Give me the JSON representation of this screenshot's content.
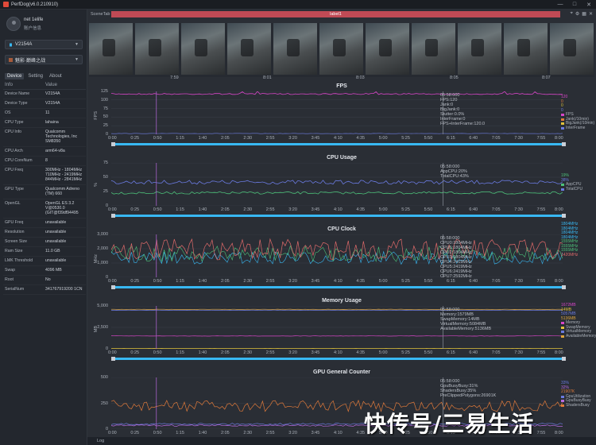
{
  "window": {
    "title": "PerfDog(v6.0.210910)",
    "controls": [
      "—",
      "□",
      "✕"
    ]
  },
  "user": {
    "name": "net 1elife",
    "sub": "账户信息"
  },
  "device_selector": {
    "value": "V2154A"
  },
  "app_selector": {
    "value": "魅影·巅峰之战"
  },
  "tabs": [
    "Device",
    "Setting",
    "About"
  ],
  "info_table": {
    "headers": [
      "Info",
      "Value"
    ],
    "rows": [
      {
        "k": "Device Name",
        "v": "V2154A"
      },
      {
        "k": "Device Type",
        "v": "V2154A"
      },
      {
        "k": "OS",
        "v": "11"
      },
      {
        "k": "CPU Type",
        "v": "lahaina"
      },
      {
        "k": "CPU Info",
        "v": "Qualcomm Technologies, Inc SM8350"
      },
      {
        "k": "CPU Arch",
        "v": "arm64-v8a"
      },
      {
        "k": "CPU CoreNum",
        "v": "8"
      },
      {
        "k": "CPU Freq",
        "v": "300MHz - 1804MHz 710MHz - 2419MHz 844MHz - 2841MHz"
      },
      {
        "k": "GPU Type",
        "v": "Qualcomm Adreno (TM) 660"
      },
      {
        "k": "OpenGL",
        "v": "OpenGL ES 3.2 V@0530.0 (GIT@f39df94495"
      },
      {
        "k": "GPU Freq",
        "v": "unavailable"
      },
      {
        "k": "Resolution",
        "v": "unavailable"
      },
      {
        "k": "Screen Size",
        "v": "unavailable"
      },
      {
        "k": "Ram Size",
        "v": "11.0 GB"
      },
      {
        "k": "LMK Threshold",
        "v": "unavailable"
      },
      {
        "k": "Swap",
        "v": "4096 MB"
      },
      {
        "k": "Root",
        "v": "No"
      },
      {
        "k": "SerialNum",
        "v": "341767919200 1CN"
      }
    ]
  },
  "scene": {
    "label": "SceneTab",
    "bar_label": "label1"
  },
  "screenshot_times": [
    "7:59",
    "8:01",
    "8:03",
    "8:05",
    "8:07"
  ],
  "x_ticks": [
    "0:00",
    "0:25",
    "0:50",
    "1:15",
    "1:40",
    "2:05",
    "2:30",
    "2:55",
    "3:20",
    "3:45",
    "4:10",
    "4:35",
    "5:00",
    "5:25",
    "5:50",
    "6:15",
    "6:40",
    "7:05",
    "7:30",
    "7:55",
    "8:00"
  ],
  "panels": {
    "fps": {
      "title": "FPS",
      "ylabel": "FPS",
      "yticks": [
        "125",
        "100",
        "75",
        "50",
        "25",
        "0"
      ],
      "info": [
        "05:58:000",
        "FPS:120",
        "Jank:0",
        "BigJank:0",
        "Stutter:0.0%",
        "InterFrame:0",
        "FPS+InterFrame:120.0"
      ],
      "legend": [
        {
          "value": "120",
          "name": "FPS",
          "color": "#d846c8"
        },
        {
          "value": "0",
          "name": "Jank(/10min)",
          "color": "#e07a3a"
        },
        {
          "value": "0",
          "name": "BigJank(/10min)",
          "color": "#e0c23a"
        },
        {
          "value": "0",
          "name": "InterFrame",
          "color": "#6a7ae0"
        }
      ]
    },
    "cpu_usage": {
      "title": "CPU Usage",
      "ylabel": "%",
      "yticks": [
        "75",
        "50",
        "25",
        "0"
      ],
      "info": [
        "05:58:000",
        "AppCPU:20%",
        "TotalCPU:43%"
      ],
      "legend": [
        {
          "value": "19%",
          "name": "AppCPU",
          "color": "#4dc27a"
        },
        {
          "value": "38%",
          "name": "TotalCPU",
          "color": "#6a7ae0"
        }
      ]
    },
    "cpu_clock": {
      "title": "CPU Clock",
      "ylabel": "MHz",
      "yticks": [
        "3,000",
        "2,000",
        "1,000",
        "0"
      ],
      "info": [
        "05:58:000",
        "CPU0:1804MHz",
        "CPU1:1804MHz",
        "CPU2:1804MHz",
        "CPU3:1804MHz",
        "CPU4:2419MHz",
        "CPU5:2419MHz",
        "CPU6:2419MHz",
        "CPU7:2592MHz"
      ],
      "legend": [
        {
          "value": "1804MHz",
          "color": "#38b8f2"
        },
        {
          "value": "1804MHz",
          "color": "#38b8f2"
        },
        {
          "value": "1804MHz",
          "color": "#38b8f2"
        },
        {
          "value": "1804MHz",
          "color": "#38b8f2"
        },
        {
          "value": "1555MHz",
          "color": "#4dc27a"
        },
        {
          "value": "1555MHz",
          "color": "#4dc27a"
        },
        {
          "value": "1555MHz",
          "color": "#4dc27a"
        },
        {
          "value": "1420MHz",
          "color": "#e06a6a"
        }
      ]
    },
    "memory": {
      "title": "Memory Usage",
      "ylabel": "MB",
      "yticks": [
        "5,000",
        "2,500",
        "0"
      ],
      "info": [
        "05:58:000",
        "Memory:1579MB",
        "SwapMemory:14MB",
        "VirtualMemory:5084MB",
        "AvailableMemory:5136MB"
      ],
      "legend": [
        {
          "value": "1672MB",
          "name": "Memory",
          "color": "#d846c8"
        },
        {
          "value": "14MB",
          "name": "SwapMemory",
          "color": "#e0c23a"
        },
        {
          "value": "5057MB",
          "name": "VirtualMemory",
          "color": "#6a7ae0"
        },
        {
          "value": "5136MB",
          "name": "AvailableMemory",
          "color": "#e0a63a"
        }
      ]
    },
    "gpu": {
      "title": "GPU General Counter",
      "yticks": [
        "500",
        "250",
        "0"
      ],
      "info": [
        "05:58:000",
        "GpuBusyBusy:31%",
        "ShadersBusy:35%",
        "PreClippedPolygons:26901K"
      ],
      "legend": [
        {
          "value": "33%",
          "name": "GpuUtilization",
          "color": "#6a7ae0"
        },
        {
          "value": "32%",
          "name": "GpuBusyBusy",
          "color": "#b86ae0"
        },
        {
          "value": "21907K",
          "name": "ShadersBusy",
          "color": "#e07a3a"
        }
      ]
    }
  },
  "log_label": "Log",
  "watermark": "快传号/三易生活"
}
